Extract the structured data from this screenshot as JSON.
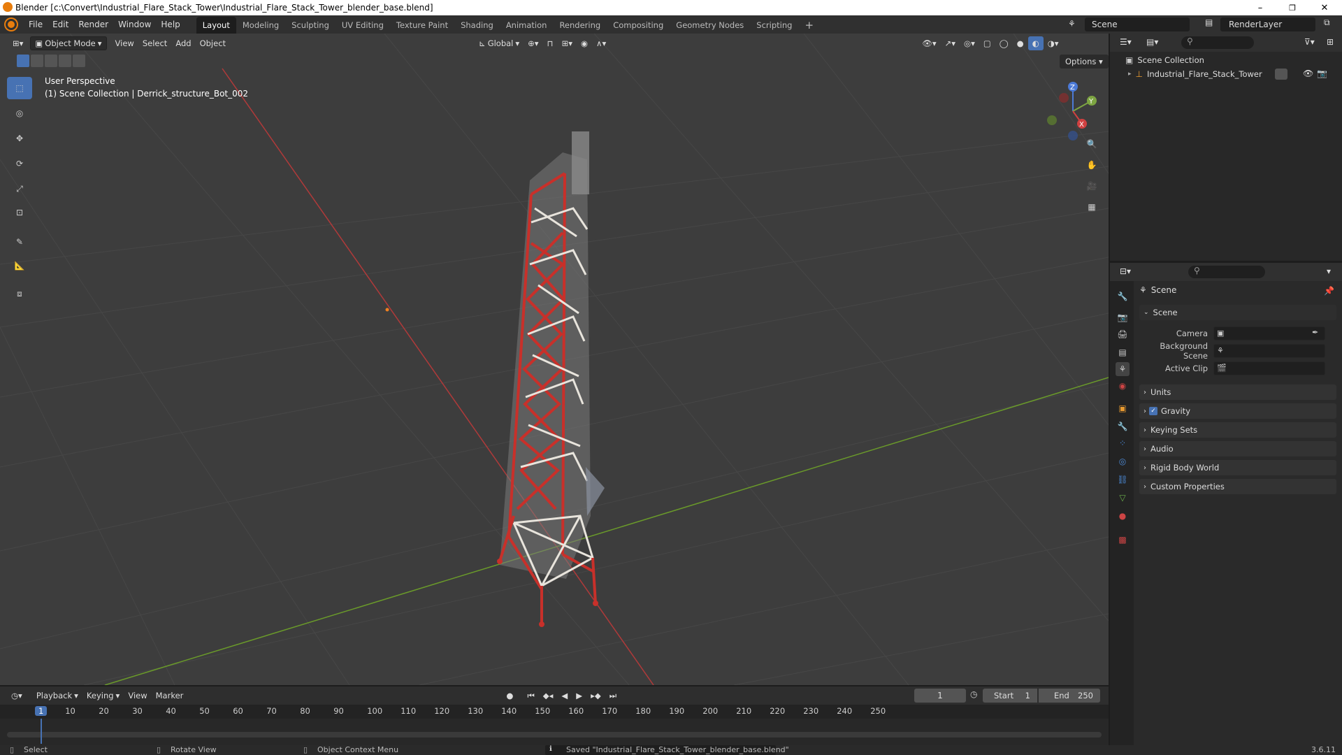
{
  "window": {
    "title": "Blender [c:\\Convert\\Industrial_Flare_Stack_Tower\\Industrial_Flare_Stack_Tower_blender_base.blend]",
    "minimize": "–",
    "maximize": "❐",
    "close": "✕"
  },
  "menus": [
    "File",
    "Edit",
    "Render",
    "Window",
    "Help"
  ],
  "workspaces": [
    "Layout",
    "Modeling",
    "Sculpting",
    "UV Editing",
    "Texture Paint",
    "Shading",
    "Animation",
    "Rendering",
    "Compositing",
    "Geometry Nodes",
    "Scripting"
  ],
  "active_workspace": "Layout",
  "scene_name": "Scene",
  "view_layer": "RenderLayer",
  "viewport": {
    "mode": "Object Mode",
    "menus": [
      "View",
      "Select",
      "Add",
      "Object"
    ],
    "orientation": "Global",
    "options_label": "Options",
    "perspective_label": "User Perspective",
    "context_label": "(1) Scene Collection | Derrick_structure_Bot_002",
    "gizmo_axes": {
      "x": "X",
      "y": "Y",
      "z": "Z"
    }
  },
  "outliner": {
    "root": "Scene Collection",
    "items": [
      {
        "name": "Industrial_Flare_Stack_Tower"
      }
    ]
  },
  "properties": {
    "header": "Scene",
    "section": "Scene",
    "fields": [
      {
        "label": "Camera"
      },
      {
        "label": "Background Scene"
      },
      {
        "label": "Active Clip"
      }
    ],
    "panels": [
      "Units",
      "Gravity",
      "Keying Sets",
      "Audio",
      "Rigid Body World",
      "Custom Properties"
    ],
    "gravity_checked": true
  },
  "timeline": {
    "menus": [
      "Playback",
      "Keying",
      "View",
      "Marker"
    ],
    "current_frame": "1",
    "start_label": "Start",
    "start": "1",
    "end_label": "End",
    "end": "250",
    "ruler": [
      "1",
      "10",
      "20",
      "30",
      "40",
      "50",
      "60",
      "70",
      "80",
      "90",
      "100",
      "110",
      "120",
      "130",
      "140",
      "150",
      "160",
      "170",
      "180",
      "190",
      "200",
      "210",
      "220",
      "230",
      "240",
      "250"
    ]
  },
  "statusbar": {
    "select": "Select",
    "rotate": "Rotate View",
    "context": "Object Context Menu",
    "message": "Saved \"Industrial_Flare_Stack_Tower_blender_base.blend\"",
    "version": "3.6.11"
  },
  "colors": {
    "accent": "#4772b3",
    "x_axis": "#b03a3a",
    "y_axis": "#6a9a2a",
    "tower_red": "#c8302a",
    "tower_white": "#e8e4dc"
  }
}
